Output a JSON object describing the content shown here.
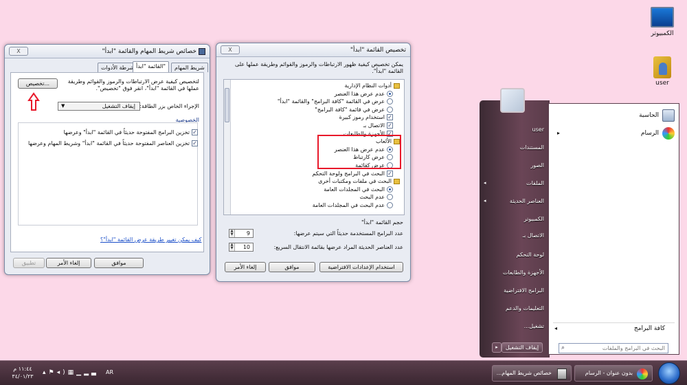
{
  "desktop": {
    "icons": [
      {
        "label": "الكمبيوتر",
        "icon": "computer-icon"
      },
      {
        "label": "user",
        "icon": "user-folder-icon"
      }
    ]
  },
  "taskbar_win": {
    "title": "خصائص شريط المهام والقائمة \"ابدأ\"",
    "close": "X",
    "tabs": [
      "شريط المهام",
      "القائمة \"ابدأ\"",
      "أشرطة الأدوات"
    ],
    "customize_button": "تخصيص...",
    "desc": "لتخصيص كيفية عرض الارتباطات والرموز والقوائم وطريقة عملها في القائمة \"ابدأ\"، انقر فوق \"تخصيص\".",
    "power_label": "الإجراء الخاص بزر الطاقة:",
    "power_value": "إيقاف التشغيل",
    "privacy_header": "الخصوصية",
    "privacy1": "تخزين البرامج المفتوحة حديثاً في القائمة \"ابدأ\" وعرضها",
    "privacy2": "تخزين العناصر المفتوحة حديثاً في القائمة \"ابدأ\" وشريط المهام وعرضها",
    "link": "كيف يمكن تغيير طريقة عرض القائمة \"ابدأ\"؟",
    "ok": "موافق",
    "cancel": "إلغاء الأمر",
    "apply": "تطبيق"
  },
  "customize_win": {
    "title": "تخصيص القائمة \"ابدأ\"",
    "close": "X",
    "desc": "يمكن تخصيص كيفية ظهور الارتباطات والرموز والقوائم وطريقة عملها على القائمة \"ابدأ\".",
    "items": [
      {
        "type": "header",
        "text": "أدوات النظام الإدارية"
      },
      {
        "type": "radio",
        "on": true,
        "text": "عدم عرض هذا العنصر"
      },
      {
        "type": "radio",
        "on": false,
        "text": "عرض في القائمة \"كافة البرامج\" والقائمة \"ابدأ\""
      },
      {
        "type": "radio",
        "on": false,
        "text": "عرض في قائمة \"كافة البرامج\""
      },
      {
        "type": "check",
        "on": true,
        "text": "استخدام رموز كبيرة"
      },
      {
        "type": "check",
        "on": true,
        "text": "الاتصال بـ"
      },
      {
        "type": "check",
        "on": true,
        "text": "الأجهزة والطابعات"
      },
      {
        "type": "header",
        "text": "الألعاب"
      },
      {
        "type": "radio",
        "on": true,
        "text": "عدم عرض هذا العنصر"
      },
      {
        "type": "radio",
        "on": false,
        "text": "عرض كارتباط"
      },
      {
        "type": "radio",
        "on": false,
        "text": "عرض كقائمة"
      },
      {
        "type": "check",
        "on": true,
        "text": "البحث في البرامج ولوحة التحكم"
      },
      {
        "type": "header",
        "text": "البحث في ملفات ومكتبات أخرى"
      },
      {
        "type": "radio",
        "on": true,
        "text": "البحث في المجلدات العامة"
      },
      {
        "type": "radio",
        "on": false,
        "text": "عدم البحث"
      },
      {
        "type": "radio",
        "on": false,
        "text": "عدم البحث في المجلدات العامة"
      }
    ],
    "size_header": "حجم القائمة \"ابدأ\"",
    "recent_programs_label": "عدد البرامج المستخدمة حديثاً التي سيتم عرضها:",
    "recent_programs_value": "9",
    "jumplist_label": "عدد العناصر الحديثة المراد عرضها بقائمة الانتقال السريع:",
    "jumplist_value": "10",
    "defaults": "استخدام الإعدادات الافتراضية",
    "ok": "موافق",
    "cancel": "إلغاء الأمر"
  },
  "start_menu": {
    "pinned": [
      {
        "label": "الحاسبة",
        "icon": "calculator-icon"
      },
      {
        "label": "الرسام",
        "icon": "paint-icon"
      }
    ],
    "right_items": [
      {
        "label": "user",
        "arrow": false
      },
      {
        "label": "المستندات",
        "arrow": false
      },
      {
        "label": "الصور",
        "arrow": false
      },
      {
        "label": "الملفات",
        "arrow": true
      },
      {
        "label": "العناصر الحديثة",
        "arrow": true
      },
      {
        "label": "الكمبيوتر",
        "arrow": false
      },
      {
        "label": "الاتصال بـ",
        "arrow": false
      },
      {
        "label": "لوحة التحكم",
        "arrow": false
      },
      {
        "label": "الأجهزة والطابعات",
        "arrow": false
      },
      {
        "label": "البرامج الافتراضية",
        "arrow": false
      },
      {
        "label": "التعليمات والدعم",
        "arrow": false
      },
      {
        "label": "تشغيل...",
        "arrow": false
      }
    ],
    "all_programs": "كافة البرامج",
    "search_placeholder": "البحث في البرامج والملفات",
    "shutdown": "إيقاف التشغيل"
  },
  "taskbar": {
    "tasks": [
      {
        "label": "بدون عنوان - الرسام",
        "icon": "paint-icon"
      },
      {
        "label": "خصائص شريط المهام...",
        "icon": "taskbar-icon"
      }
    ],
    "language": "AR",
    "time": "١١:٤٤ م",
    "date": "٣٤/٠١/٢٣"
  },
  "colors": {
    "desktop": "#fcd8e8",
    "highlight_box": "#e8182a",
    "arrow": "#e8182a"
  }
}
